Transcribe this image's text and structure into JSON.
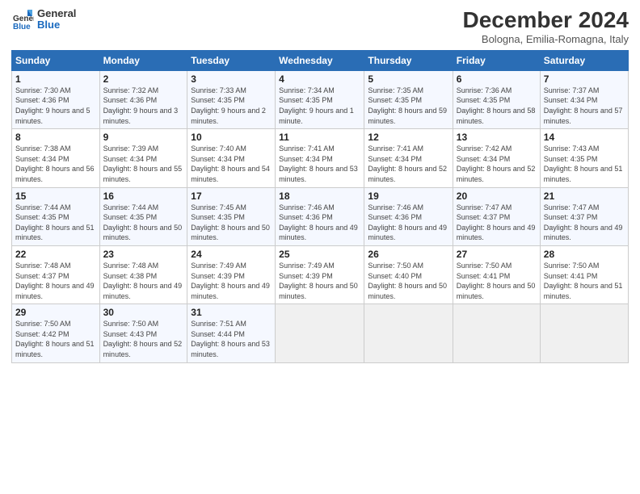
{
  "logo": {
    "general": "General",
    "blue": "Blue"
  },
  "title": "December 2024",
  "subtitle": "Bologna, Emilia-Romagna, Italy",
  "days_of_week": [
    "Sunday",
    "Monday",
    "Tuesday",
    "Wednesday",
    "Thursday",
    "Friday",
    "Saturday"
  ],
  "weeks": [
    [
      {
        "day": "1",
        "sunrise": "Sunrise: 7:30 AM",
        "sunset": "Sunset: 4:36 PM",
        "daylight": "Daylight: 9 hours and 5 minutes."
      },
      {
        "day": "2",
        "sunrise": "Sunrise: 7:32 AM",
        "sunset": "Sunset: 4:36 PM",
        "daylight": "Daylight: 9 hours and 3 minutes."
      },
      {
        "day": "3",
        "sunrise": "Sunrise: 7:33 AM",
        "sunset": "Sunset: 4:35 PM",
        "daylight": "Daylight: 9 hours and 2 minutes."
      },
      {
        "day": "4",
        "sunrise": "Sunrise: 7:34 AM",
        "sunset": "Sunset: 4:35 PM",
        "daylight": "Daylight: 9 hours and 1 minute."
      },
      {
        "day": "5",
        "sunrise": "Sunrise: 7:35 AM",
        "sunset": "Sunset: 4:35 PM",
        "daylight": "Daylight: 8 hours and 59 minutes."
      },
      {
        "day": "6",
        "sunrise": "Sunrise: 7:36 AM",
        "sunset": "Sunset: 4:35 PM",
        "daylight": "Daylight: 8 hours and 58 minutes."
      },
      {
        "day": "7",
        "sunrise": "Sunrise: 7:37 AM",
        "sunset": "Sunset: 4:34 PM",
        "daylight": "Daylight: 8 hours and 57 minutes."
      }
    ],
    [
      {
        "day": "8",
        "sunrise": "Sunrise: 7:38 AM",
        "sunset": "Sunset: 4:34 PM",
        "daylight": "Daylight: 8 hours and 56 minutes."
      },
      {
        "day": "9",
        "sunrise": "Sunrise: 7:39 AM",
        "sunset": "Sunset: 4:34 PM",
        "daylight": "Daylight: 8 hours and 55 minutes."
      },
      {
        "day": "10",
        "sunrise": "Sunrise: 7:40 AM",
        "sunset": "Sunset: 4:34 PM",
        "daylight": "Daylight: 8 hours and 54 minutes."
      },
      {
        "day": "11",
        "sunrise": "Sunrise: 7:41 AM",
        "sunset": "Sunset: 4:34 PM",
        "daylight": "Daylight: 8 hours and 53 minutes."
      },
      {
        "day": "12",
        "sunrise": "Sunrise: 7:41 AM",
        "sunset": "Sunset: 4:34 PM",
        "daylight": "Daylight: 8 hours and 52 minutes."
      },
      {
        "day": "13",
        "sunrise": "Sunrise: 7:42 AM",
        "sunset": "Sunset: 4:34 PM",
        "daylight": "Daylight: 8 hours and 52 minutes."
      },
      {
        "day": "14",
        "sunrise": "Sunrise: 7:43 AM",
        "sunset": "Sunset: 4:35 PM",
        "daylight": "Daylight: 8 hours and 51 minutes."
      }
    ],
    [
      {
        "day": "15",
        "sunrise": "Sunrise: 7:44 AM",
        "sunset": "Sunset: 4:35 PM",
        "daylight": "Daylight: 8 hours and 51 minutes."
      },
      {
        "day": "16",
        "sunrise": "Sunrise: 7:44 AM",
        "sunset": "Sunset: 4:35 PM",
        "daylight": "Daylight: 8 hours and 50 minutes."
      },
      {
        "day": "17",
        "sunrise": "Sunrise: 7:45 AM",
        "sunset": "Sunset: 4:35 PM",
        "daylight": "Daylight: 8 hours and 50 minutes."
      },
      {
        "day": "18",
        "sunrise": "Sunrise: 7:46 AM",
        "sunset": "Sunset: 4:36 PM",
        "daylight": "Daylight: 8 hours and 49 minutes."
      },
      {
        "day": "19",
        "sunrise": "Sunrise: 7:46 AM",
        "sunset": "Sunset: 4:36 PM",
        "daylight": "Daylight: 8 hours and 49 minutes."
      },
      {
        "day": "20",
        "sunrise": "Sunrise: 7:47 AM",
        "sunset": "Sunset: 4:37 PM",
        "daylight": "Daylight: 8 hours and 49 minutes."
      },
      {
        "day": "21",
        "sunrise": "Sunrise: 7:47 AM",
        "sunset": "Sunset: 4:37 PM",
        "daylight": "Daylight: 8 hours and 49 minutes."
      }
    ],
    [
      {
        "day": "22",
        "sunrise": "Sunrise: 7:48 AM",
        "sunset": "Sunset: 4:37 PM",
        "daylight": "Daylight: 8 hours and 49 minutes."
      },
      {
        "day": "23",
        "sunrise": "Sunrise: 7:48 AM",
        "sunset": "Sunset: 4:38 PM",
        "daylight": "Daylight: 8 hours and 49 minutes."
      },
      {
        "day": "24",
        "sunrise": "Sunrise: 7:49 AM",
        "sunset": "Sunset: 4:39 PM",
        "daylight": "Daylight: 8 hours and 49 minutes."
      },
      {
        "day": "25",
        "sunrise": "Sunrise: 7:49 AM",
        "sunset": "Sunset: 4:39 PM",
        "daylight": "Daylight: 8 hours and 50 minutes."
      },
      {
        "day": "26",
        "sunrise": "Sunrise: 7:50 AM",
        "sunset": "Sunset: 4:40 PM",
        "daylight": "Daylight: 8 hours and 50 minutes."
      },
      {
        "day": "27",
        "sunrise": "Sunrise: 7:50 AM",
        "sunset": "Sunset: 4:41 PM",
        "daylight": "Daylight: 8 hours and 50 minutes."
      },
      {
        "day": "28",
        "sunrise": "Sunrise: 7:50 AM",
        "sunset": "Sunset: 4:41 PM",
        "daylight": "Daylight: 8 hours and 51 minutes."
      }
    ],
    [
      {
        "day": "29",
        "sunrise": "Sunrise: 7:50 AM",
        "sunset": "Sunset: 4:42 PM",
        "daylight": "Daylight: 8 hours and 51 minutes."
      },
      {
        "day": "30",
        "sunrise": "Sunrise: 7:50 AM",
        "sunset": "Sunset: 4:43 PM",
        "daylight": "Daylight: 8 hours and 52 minutes."
      },
      {
        "day": "31",
        "sunrise": "Sunrise: 7:51 AM",
        "sunset": "Sunset: 4:44 PM",
        "daylight": "Daylight: 8 hours and 53 minutes."
      },
      null,
      null,
      null,
      null
    ]
  ]
}
